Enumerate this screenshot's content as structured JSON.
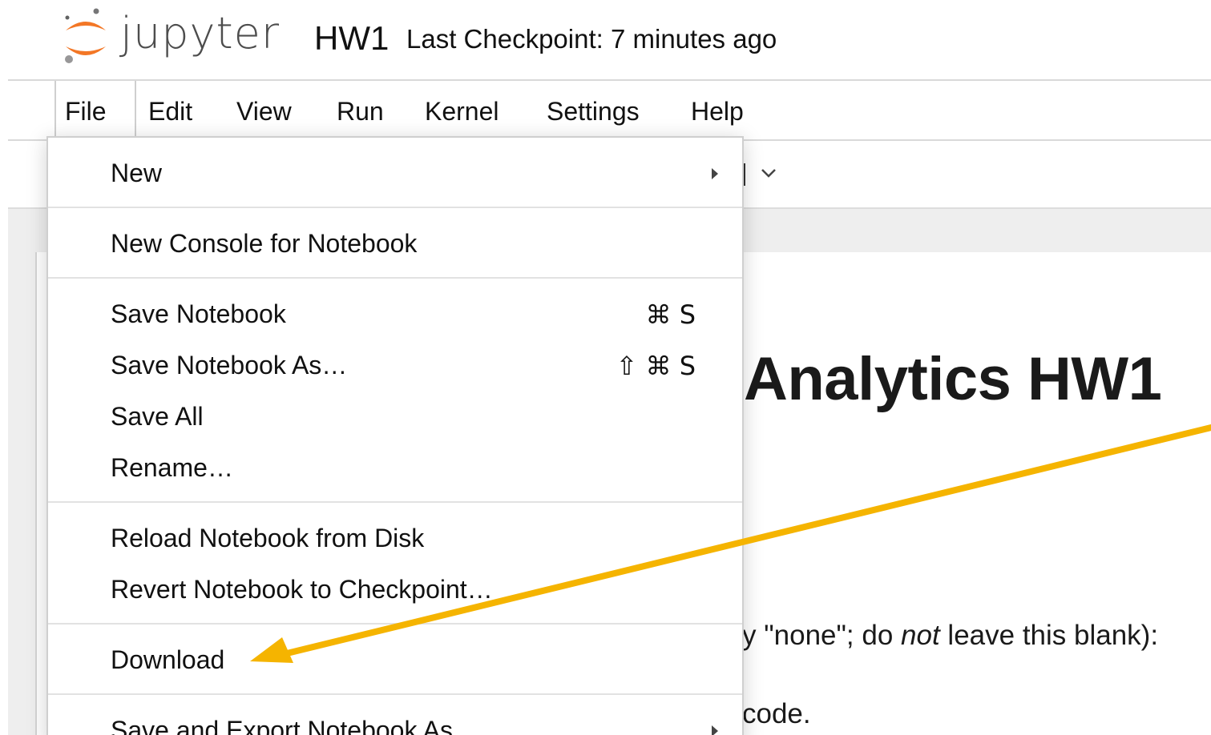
{
  "header": {
    "logo_word": "jupyter",
    "notebook_name": "HW1",
    "checkpoint": "Last Checkpoint: 7 minutes ago"
  },
  "menubar": {
    "items": [
      "File",
      "Edit",
      "View",
      "Run",
      "Kernel",
      "Settings",
      "Help"
    ]
  },
  "file_menu": {
    "new": "New",
    "new_console": "New Console for Notebook",
    "save": "Save Notebook",
    "save_shortcut": "⌘ S",
    "save_as": "Save Notebook As…",
    "save_as_shortcut": "⇧ ⌘ S",
    "save_all": "Save All",
    "rename": "Rename…",
    "reload": "Reload Notebook from Disk",
    "revert": "Revert Notebook to Checkpoint…",
    "download": "Download",
    "save_export": "Save and Export Notebook As"
  },
  "notebook": {
    "heading": "Analytics HW1",
    "line1_pre": "y \"none\"; do ",
    "line1_em": "not",
    "line1_post": " leave this blank):",
    "line2": "code."
  },
  "annotation": {
    "arrow_color": "#f5b400"
  }
}
